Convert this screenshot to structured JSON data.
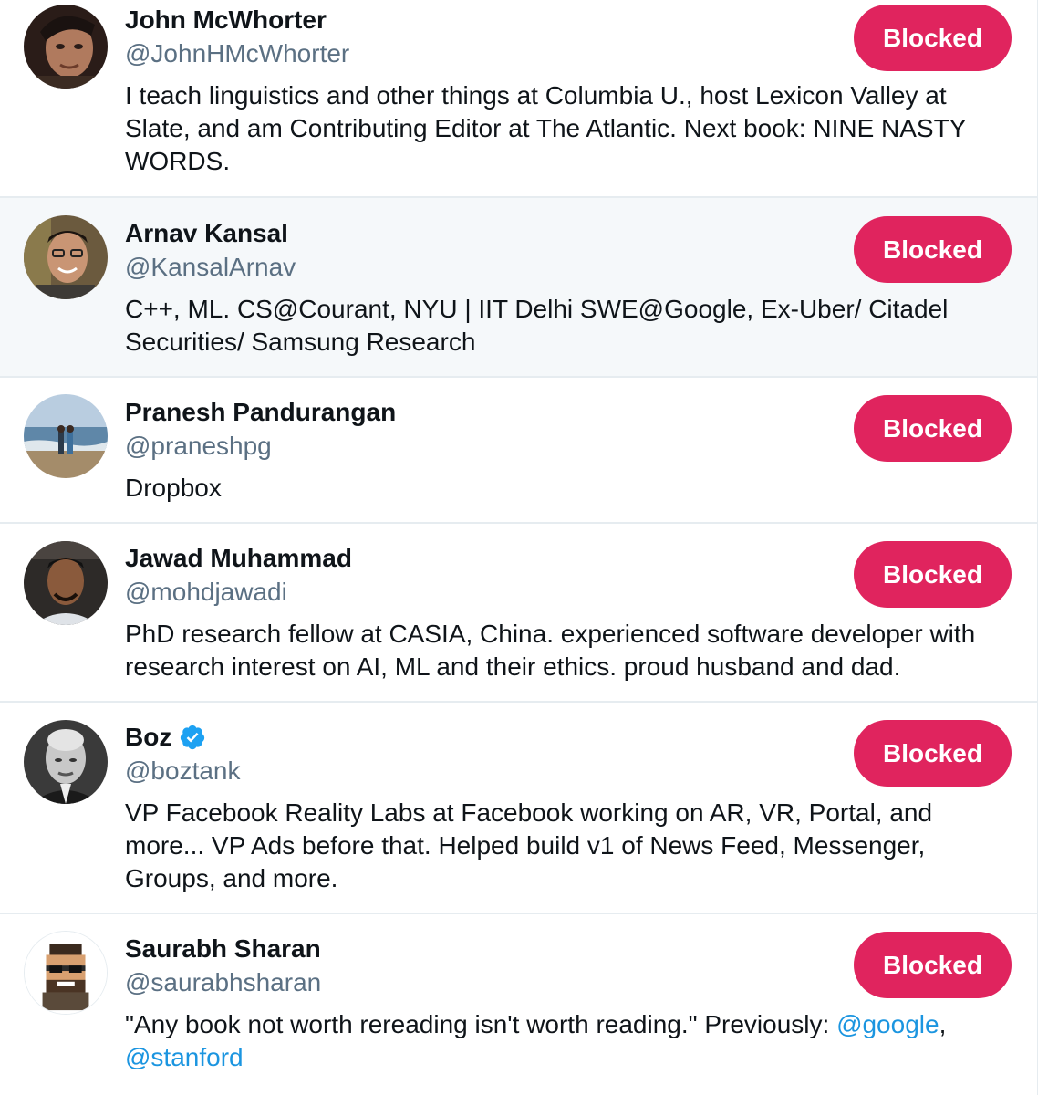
{
  "blocked_accounts": [
    {
      "name": "John McWhorter",
      "handle": "@JohnHMcWhorter",
      "bio": "I teach linguistics and other things at Columbia U., host Lexicon Valley at Slate, and am Contributing Editor at The Atlantic. Next book: NINE NASTY WORDS.",
      "button_label": "Blocked"
    },
    {
      "name": "Arnav Kansal",
      "handle": "@KansalArnav",
      "bio": "C++, ML. CS@Courant, NYU | IIT Delhi SWE@Google, Ex-Uber/ Citadel Securities/ Samsung Research",
      "button_label": "Blocked"
    },
    {
      "name": "Pranesh Pandurangan",
      "handle": "@praneshpg",
      "bio": "Dropbox",
      "button_label": "Blocked"
    },
    {
      "name": "Jawad Muhammad",
      "handle": "@mohdjawadi",
      "bio": "PhD research fellow at CASIA, China. experienced software developer with research interest on AI, ML and their ethics. proud husband and dad.",
      "button_label": "Blocked"
    },
    {
      "name": "Boz",
      "handle": "@boztank",
      "verified_icon": "verified-badge-icon",
      "bio": "VP Facebook Reality Labs at Facebook working on AR, VR, Portal, and more... VP Ads before that. Helped build v1 of News Feed, Messenger, Groups, and more.",
      "button_label": "Blocked"
    },
    {
      "name": "Saurabh Sharan",
      "handle": "@saurabhsharan",
      "bio_text": "\"Any book not worth rereading isn't worth reading.\" Previously: ",
      "bio_link_1": "@google",
      "bio_sep": ",",
      "bio_link_2": "@stanford",
      "button_label": "Blocked"
    }
  ],
  "colors": {
    "blocked_button": "#e0245e",
    "handle_text": "#5b7083",
    "link": "#1b95e0",
    "verified_badge": "#1da1f2",
    "hover_row_background": "#f5f8fa"
  }
}
